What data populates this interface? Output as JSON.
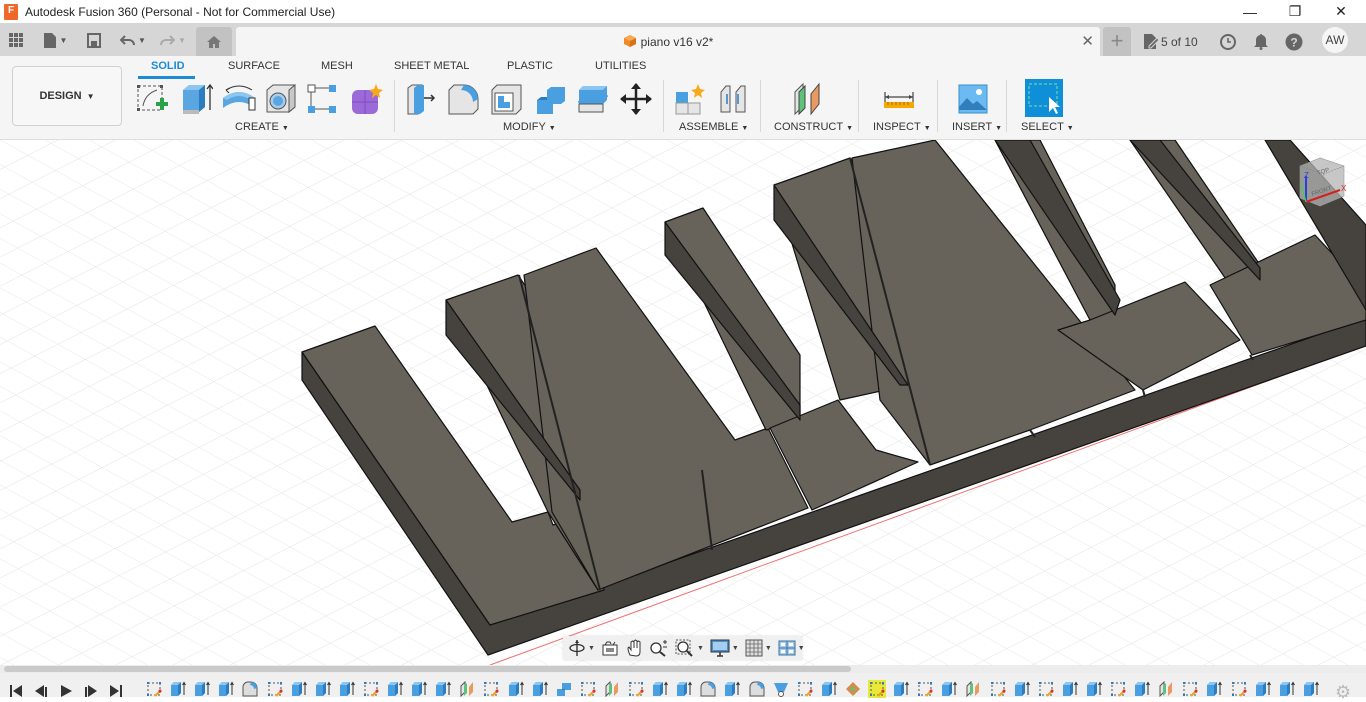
{
  "window": {
    "title": "Autodesk Fusion 360 (Personal - Not for Commercial Use)",
    "logo_letter": "F",
    "controls": {
      "minimize": "—",
      "maximize": "❐",
      "close": "✕"
    }
  },
  "tabbar": {
    "document_tab": {
      "title": "piano v16 v2*",
      "close": "✕"
    },
    "new_tab": "+",
    "versions": "5 of 10",
    "user_initials": "AW"
  },
  "toolbar": {
    "workspace": "DESIGN",
    "workspace_tabs": [
      {
        "label": "SOLID",
        "active": true
      },
      {
        "label": "SURFACE",
        "active": false
      },
      {
        "label": "MESH",
        "active": false
      },
      {
        "label": "SHEET METAL",
        "active": false
      },
      {
        "label": "PLASTIC",
        "active": false
      },
      {
        "label": "UTILITIES",
        "active": false
      }
    ],
    "groups": {
      "create": "CREATE",
      "modify": "MODIFY",
      "assemble": "ASSEMBLE",
      "construct": "CONSTRUCT",
      "inspect": "INSPECT",
      "insert": "INSERT",
      "select": "SELECT"
    },
    "tools": {
      "create": [
        "create-sketch",
        "extrude",
        "revolve",
        "hole",
        "pattern",
        "create-form"
      ],
      "modify": [
        "press-pull",
        "fillet",
        "shell",
        "combine",
        "split-body",
        "move-copy"
      ],
      "assemble": [
        "new-component",
        "joint"
      ],
      "construct": [
        "offset-plane"
      ],
      "inspect": [
        "measure"
      ],
      "insert": [
        "insert-canvas"
      ],
      "select": [
        "window-select"
      ]
    }
  },
  "viewcube": {
    "top": "TOP",
    "front": "FRONT",
    "axis_x": "X",
    "axis_z": "Z"
  },
  "navbar": {
    "items": [
      "orbit",
      "look-at",
      "pan",
      "zoom",
      "zoom-window",
      "display-settings",
      "grid-snaps",
      "viewports"
    ]
  },
  "timeline": {
    "controls": [
      "go-to-start",
      "step-back",
      "play",
      "step-forward",
      "go-to-end"
    ],
    "features": [
      "sketch",
      "extrude",
      "extrude",
      "extrude",
      "fillet",
      "sketch",
      "extrude",
      "extrude",
      "extrude",
      "sketch",
      "extrude",
      "extrude",
      "extrude",
      "plane",
      "sketch",
      "extrude",
      "extrude",
      "combine",
      "sketch",
      "plane",
      "sketch",
      "extrude",
      "extrude",
      "fillet",
      "extrude",
      "fillet",
      "loft",
      "sketch",
      "extrude",
      "appearance",
      "sketch",
      "extrude",
      "sketch",
      "extrude",
      "plane",
      "sketch",
      "extrude",
      "sketch",
      "extrude",
      "extrude",
      "sketch",
      "extrude",
      "plane",
      "sketch",
      "extrude",
      "sketch",
      "extrude",
      "extrude",
      "extrude"
    ],
    "current_index": 30
  },
  "colors": {
    "accent": "#1d8ad6",
    "model_top": "#67625a",
    "model_side": "#46433e",
    "grid": "#e2e2e2",
    "timeline_marker": "#e8e83a"
  }
}
